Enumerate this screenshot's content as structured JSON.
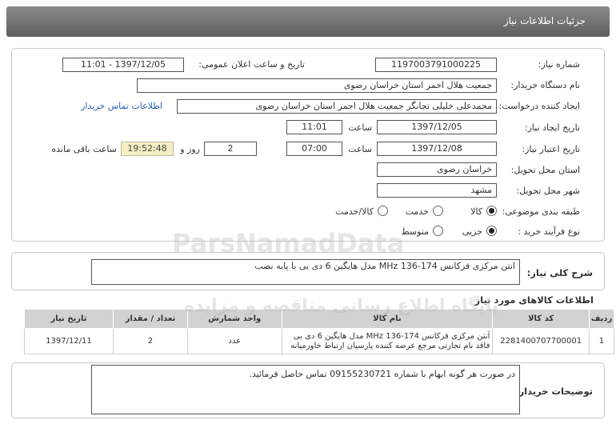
{
  "header": {
    "title": "جزئیات اطلاعات نیاز"
  },
  "form": {
    "need_number_label": "شماره نیاز:",
    "need_number": "1197003791000225",
    "announce_label": "تاریخ و ساعت اعلان عمومی:",
    "announce_value": "1397/12/05 - 11:01",
    "buyer_org_label": "نام دستگاه خریدار:",
    "buyer_org": "جمعیت هلال احمر استان خراسان رضوی",
    "creator_label": "ایجاد کننده درخواست:",
    "creator": "محمدعلی خلیلی تجانگر جمعیت هلال احمر استان خراسان رضوی",
    "contact_link": "اطلاعات تماس خریدار",
    "created_date_label": "تاریخ ایجاد نیاز:",
    "created_date": "1397/12/05",
    "time_label": "ساعت",
    "created_time": "11:01",
    "validity_label": "تاریخ اعتبار نیاز:",
    "validity_date": "1397/12/08",
    "validity_time": "07:00",
    "days_value": "2",
    "days_label": "روز و",
    "remaining_time": "19:52:48",
    "remaining_label": "ساعت باقی مانده",
    "province_label": "استان محل تحویل:",
    "province": "خراسان رضوی",
    "city_label": "شهر محل تحویل:",
    "city": "مشهد",
    "category_label": "طبقه بندی موضوعی:",
    "category_options": [
      "کالا",
      "خدمت",
      "کالا/خدمت"
    ],
    "category_selected": "کالا",
    "process_label": "نوع فرآیند خرید :",
    "process_options": [
      "جزیی",
      "متوسط"
    ],
    "process_selected": "جزیی"
  },
  "summary": {
    "label": "شرح کلی نیاز:",
    "value": "انتن مرکزی فرکانس 174-136 MHz مدل هایگین 6 دی بی با پایه نصب"
  },
  "goods": {
    "title": "اطلاعات کالاهای مورد نیاز",
    "columns": [
      "ردیف",
      "کد کالا",
      "نام کالا",
      "واحد شمارش",
      "تعداد / مقدار",
      "تاریخ نیاز"
    ],
    "rows": [
      {
        "index": "1",
        "code": "2281400707700001",
        "name": "آنتن مرکزی فرکانس 174-136 MHz مدل هایگین 6 دی بی فاقد نام تجارتی مرجع عرضه کننده پارسیان ارتباط خاورمیانه",
        "unit": "عدد",
        "qty": "2",
        "date": "1397/12/11"
      }
    ]
  },
  "notes": {
    "label": "توضیحات خریدار:",
    "value": "در صورت هر گونه ابهام با شماره 09155230721 تماس حاصل فرمائید."
  },
  "watermark": {
    "line1": "ParsNamadData",
    "line2": "پایگاه اطلاع رسانی مناقصه و مزایده"
  }
}
